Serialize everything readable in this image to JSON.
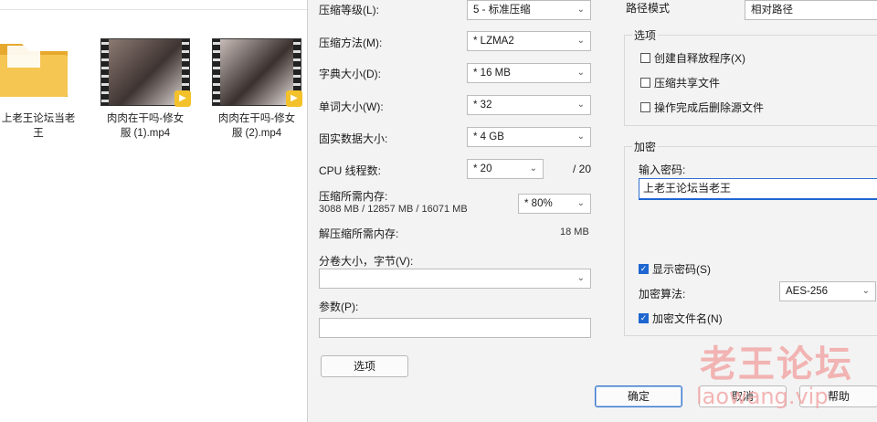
{
  "explorer": {
    "files": [
      {
        "name_line1": "上老王论坛当老",
        "name_line2": "王",
        "type": "folder"
      },
      {
        "name_line1": "肉肉在干吗-修女",
        "name_line2": "服 (1).mp4",
        "type": "video"
      },
      {
        "name_line1": "肉肉在干吗-修女",
        "name_line2": "服 (2).mp4",
        "type": "video"
      }
    ]
  },
  "dialog": {
    "compression_level": {
      "label": "压缩等级(L):",
      "value": "5 - 标准压缩"
    },
    "compression_method": {
      "label": "压缩方法(M):",
      "value": "* LZMA2"
    },
    "dictionary_size": {
      "label": "字典大小(D):",
      "value": "* 16 MB"
    },
    "word_size": {
      "label": "单词大小(W):",
      "value": "* 32"
    },
    "solid_block": {
      "label": "固实数据大小:",
      "value": "* 4 GB"
    },
    "cpu_threads": {
      "label": "CPU 线程数:",
      "value": "* 20",
      "total": "/ 20"
    },
    "memory_compress": {
      "label": "压缩所需内存:",
      "detail": "3088 MB / 12857 MB / 16071 MB",
      "value": "* 80%"
    },
    "memory_decompress": {
      "label": "解压缩所需内存:",
      "value": "18 MB"
    },
    "split_volume": {
      "label": "分卷大小，字节(V):",
      "value": ""
    },
    "parameters": {
      "label": "参数(P):",
      "value": ""
    },
    "options_button": "选项",
    "path_mode": {
      "label": "路径模式",
      "value": "相对路径"
    },
    "options_group": {
      "title": "选项",
      "items": [
        {
          "label": "创建自释放程序(X)",
          "checked": false
        },
        {
          "label": "压缩共享文件",
          "checked": false
        },
        {
          "label": "操作完成后删除源文件",
          "checked": false
        }
      ]
    },
    "encryption_group": {
      "title": "加密",
      "password_label": "输入密码:",
      "password_value": "上老王论坛当老王",
      "show_password": {
        "label": "显示密码(S)",
        "checked": true
      },
      "method_label": "加密算法:",
      "method_value": "AES-256",
      "encrypt_names": {
        "label": "加密文件名(N)",
        "checked": true
      }
    },
    "ok_button": "确定",
    "cancel_button": "取消",
    "help_button": "帮助"
  },
  "watermark": {
    "line1": "老王论坛",
    "line2": "laowang.vip"
  },
  "colors": {
    "accent": "#1e66d0",
    "dialog_bg": "#f3f3f3",
    "folder": "#f4c04e",
    "watermark": "#f2a9a9"
  }
}
